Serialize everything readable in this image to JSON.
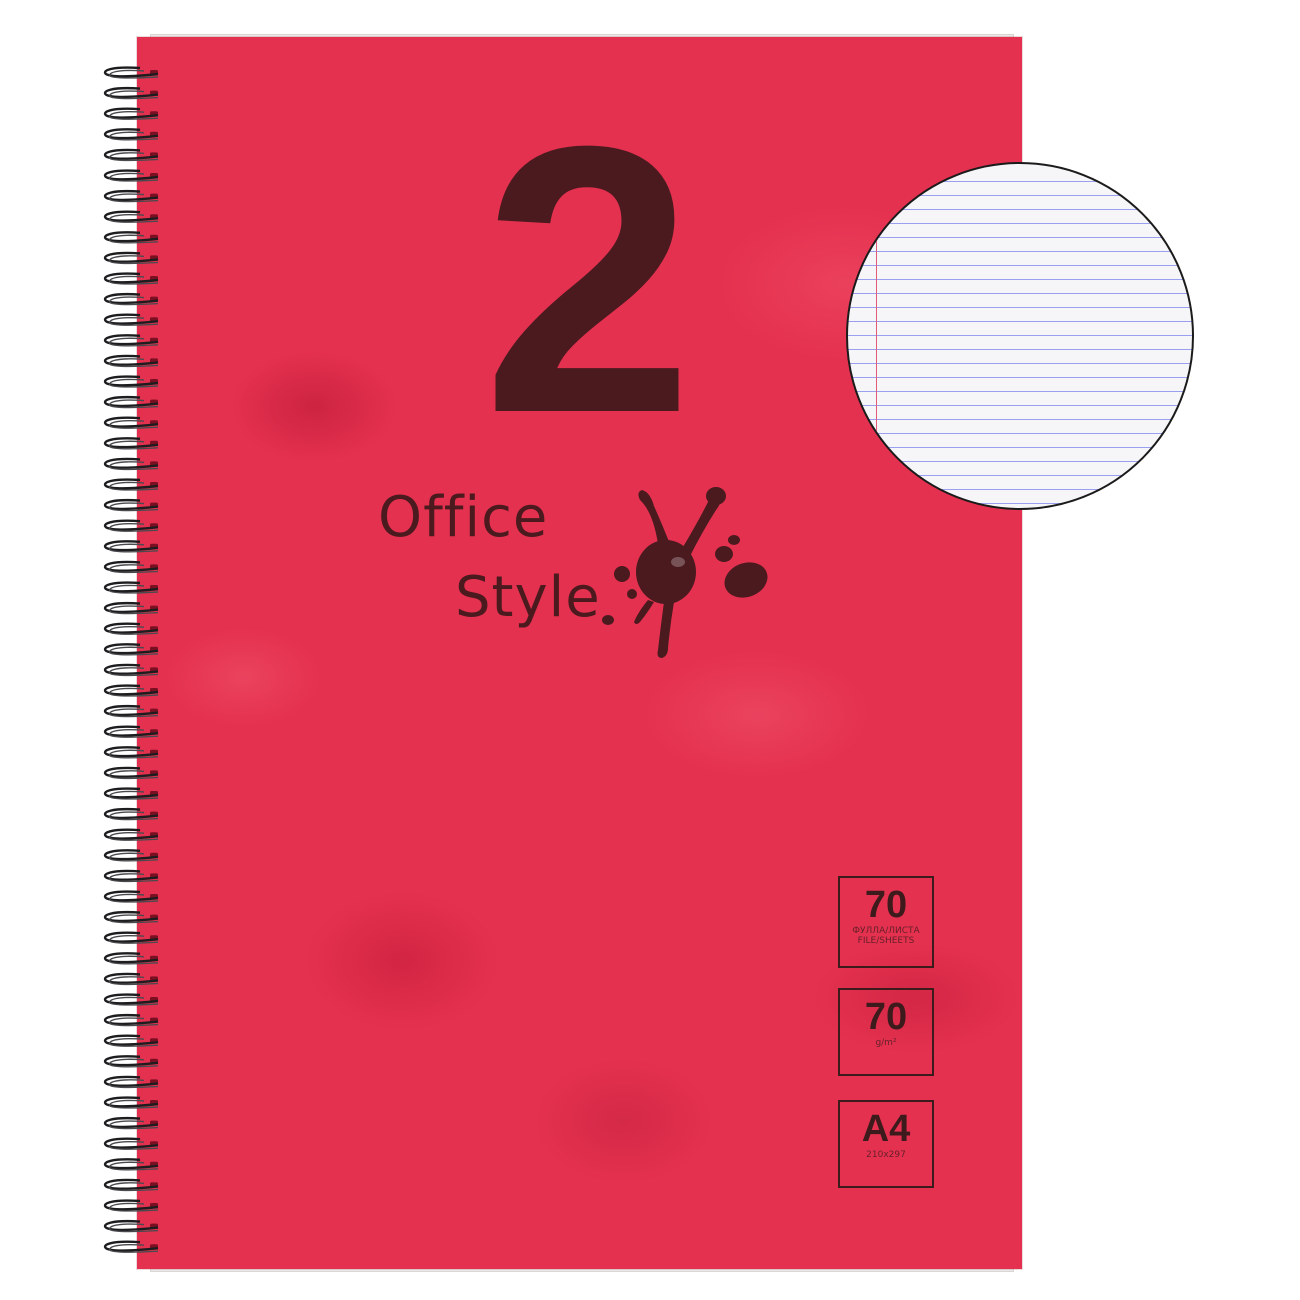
{
  "notebook": {
    "number": "2",
    "brand_line1": "Office",
    "brand_line2": "Style",
    "cover_color": "#e4314f",
    "ink_color": "#4a1a1f",
    "specs": [
      {
        "value": "70",
        "unit": "ФУЛЛА/ЛИСТА FILE/SHEETS"
      },
      {
        "value": "70",
        "unit": "g/m²"
      },
      {
        "value": "A4",
        "unit": "210x297"
      }
    ]
  },
  "page_preview": {
    "ruling": "lined",
    "line_color": "#9b9ff0",
    "margin_color": "#e05a7a"
  }
}
